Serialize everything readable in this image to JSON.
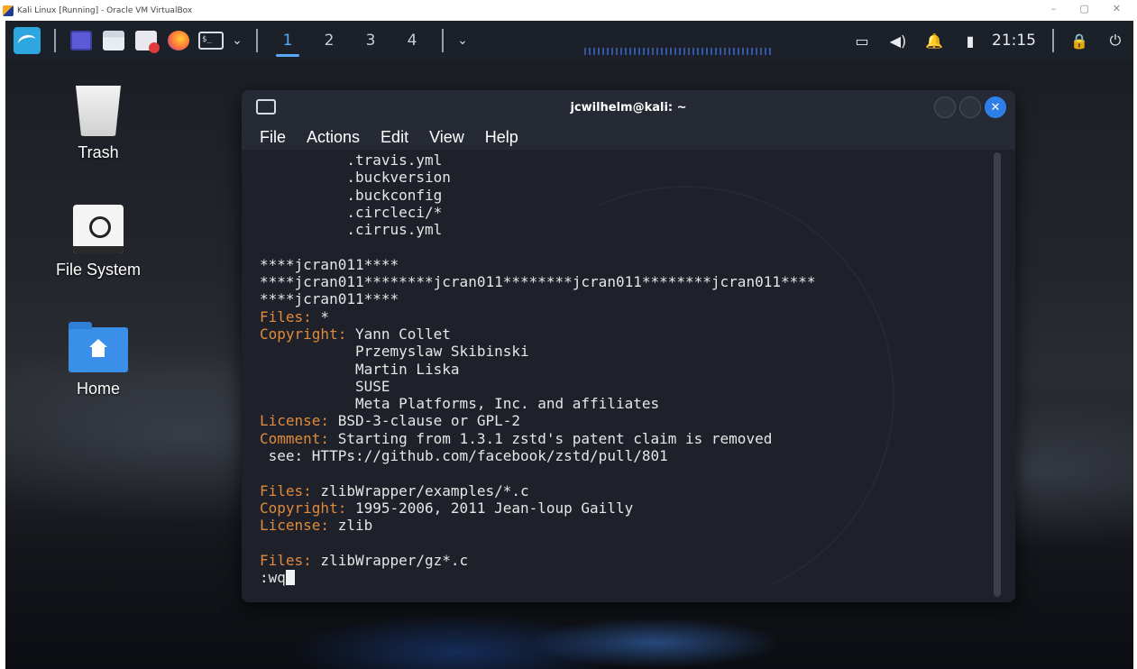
{
  "host": {
    "window_title": "Kali Linux [Running] - Oracle VM VirtualBox",
    "controls": [
      "–",
      "▢",
      "✕"
    ]
  },
  "panel": {
    "workspaces": [
      "1",
      "2",
      "3",
      "4"
    ],
    "active_workspace": "1",
    "clock": "21:15"
  },
  "desktop": {
    "icons": [
      {
        "label": "Trash"
      },
      {
        "label": "File System"
      },
      {
        "label": "Home"
      }
    ]
  },
  "terminal": {
    "title": "jcwilhelm@kali: ~",
    "menu": [
      "File",
      "Actions",
      "Edit",
      "View",
      "Help"
    ],
    "lines": [
      {
        "key": "",
        "text": "          .travis.yml"
      },
      {
        "key": "",
        "text": "          .buckversion"
      },
      {
        "key": "",
        "text": "          .buckconfig"
      },
      {
        "key": "",
        "text": "          .circleci/*"
      },
      {
        "key": "",
        "text": "          .cirrus.yml"
      },
      {
        "key": "",
        "text": ""
      },
      {
        "key": "",
        "text": "****jcran011****"
      },
      {
        "key": "",
        "text": "****jcran011********jcran011********jcran011********jcran011****"
      },
      {
        "key": "",
        "text": "****jcran011****"
      },
      {
        "key": "Files:",
        "text": " *"
      },
      {
        "key": "Copyright:",
        "text": " Yann Collet"
      },
      {
        "key": "",
        "text": "           Przemyslaw Skibinski"
      },
      {
        "key": "",
        "text": "           Martin Liska"
      },
      {
        "key": "",
        "text": "           SUSE"
      },
      {
        "key": "",
        "text": "           Meta Platforms, Inc. and affiliates"
      },
      {
        "key": "License:",
        "text": " BSD-3-clause or GPL-2"
      },
      {
        "key": "Comment:",
        "text": " Starting from 1.3.1 zstd's patent claim is removed"
      },
      {
        "key": "",
        "text": " see: HTTPs://github.com/facebook/zstd/pull/801"
      },
      {
        "key": "",
        "text": ""
      },
      {
        "key": "Files:",
        "text": " zlibWrapper/examples/*.c"
      },
      {
        "key": "Copyright:",
        "text": " 1995-2006, 2011 Jean-loup Gailly"
      },
      {
        "key": "License:",
        "text": " zlib"
      },
      {
        "key": "",
        "text": ""
      },
      {
        "key": "Files:",
        "text": " zlibWrapper/gz*.c"
      }
    ],
    "command_line": ":wq"
  }
}
